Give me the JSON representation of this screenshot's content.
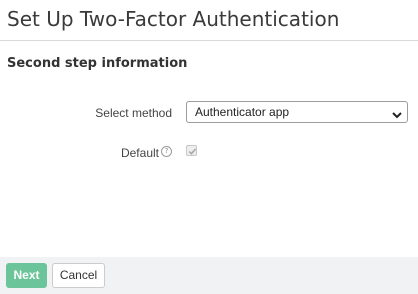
{
  "header": {
    "title": "Set Up Two-Factor Authentication"
  },
  "section": {
    "title": "Second step information"
  },
  "form": {
    "method": {
      "label": "Select method",
      "value": "Authenticator app",
      "icon": "chevron-down-icon"
    },
    "default": {
      "label": "Default",
      "help_icon": "help-icon",
      "help_glyph": "?",
      "checked": true,
      "disabled": true
    }
  },
  "footer": {
    "next_label": "Next",
    "cancel_label": "Cancel"
  },
  "colors": {
    "accent": "#6cc59a",
    "footer_bg": "#f0f2f4"
  }
}
